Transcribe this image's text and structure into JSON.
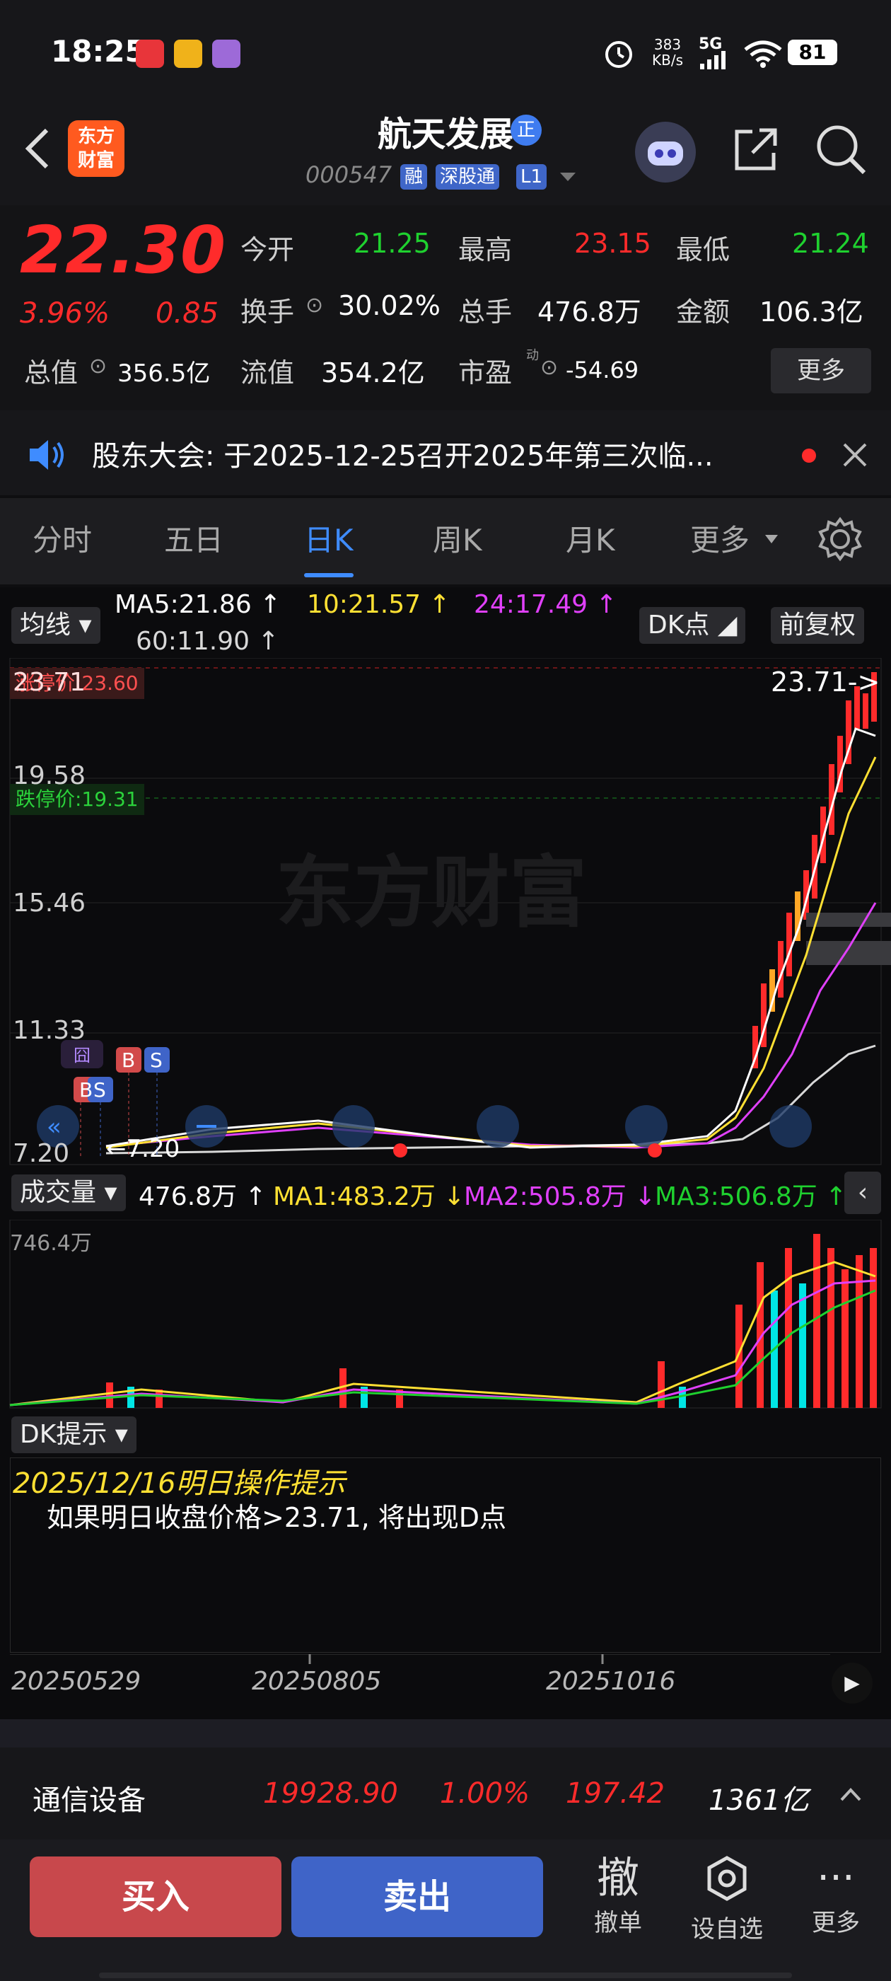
{
  "status_bar": {
    "time": "18:25",
    "net_speed_value": "383",
    "net_speed_unit": "KB/s",
    "network": "5G",
    "battery": "81"
  },
  "header": {
    "app_logo_line1": "东方",
    "app_logo_line2": "财富",
    "stock_name": "航天发展",
    "badge": "正",
    "stock_code": "000547",
    "tags": [
      "融",
      "深股通",
      "L1"
    ]
  },
  "quote": {
    "price": "22.30",
    "change_pct": "3.96%",
    "change_amt": "0.85",
    "open_label": "今开",
    "open": "21.25",
    "high_label": "最高",
    "high": "23.15",
    "low_label": "最低",
    "low": "21.24",
    "turnover_label": "换手",
    "turnover": "30.02%",
    "volume_label": "总手",
    "volume": "476.8万",
    "amount_label": "金额",
    "amount": "106.3亿",
    "mktcap_label": "总值",
    "mktcap": "356.5亿",
    "float_label": "流值",
    "float": "354.2亿",
    "pe_label": "市盈",
    "pe_sup": "动",
    "pe": "-54.69",
    "more_label": "更多"
  },
  "notice": {
    "text": "股东大会: 于2025-12-25召开2025年第三次临..."
  },
  "tabs": [
    {
      "label": "分时",
      "active": false
    },
    {
      "label": "五日",
      "active": false
    },
    {
      "label": "日K",
      "active": true
    },
    {
      "label": "周K",
      "active": false
    },
    {
      "label": "月K",
      "active": false
    },
    {
      "label": "更多",
      "active": false
    }
  ],
  "kline": {
    "ma_button": "均线",
    "ma5": "MA5:21.86",
    "ma10": "10:21.57",
    "ma24": "24:17.49",
    "ma60": "60:11.90",
    "dk_button": "DK点",
    "adjust_button": "前复权",
    "limit_up": "涨停价:23.60",
    "limit_down": "跌停价:19.31",
    "max_arrow": "23.71->",
    "min_arrow": "7.20",
    "y_ticks": [
      "23.71",
      "19.58",
      "15.46",
      "11.33",
      "7.20"
    ],
    "watermark": "东方财富",
    "marker_liang": "囧",
    "marker_b": "B",
    "marker_s": "S"
  },
  "volume": {
    "button": "成交量",
    "value": "476.8万",
    "ma1": "MA1:483.2万",
    "ma2": "MA2:505.8万",
    "ma3": "MA3:506.8万",
    "max_label": "746.4万"
  },
  "dk_tip": {
    "button": "DK提示",
    "title": "2025/12/16明日操作提示",
    "text": "如果明日收盘价格>23.71, 将出现D点"
  },
  "dates": [
    "20250529",
    "20250805",
    "20251016"
  ],
  "sector": {
    "name": "通信设备",
    "index": "19928.90",
    "pct": "1.00%",
    "change": "197.42",
    "amount": "1361亿"
  },
  "bottom": {
    "buy": "买入",
    "sell": "卖出",
    "cancel_icon_text": "撤",
    "cancel_label": "撤单",
    "watch_label": "设自选",
    "more_label": "更多"
  },
  "colors": {
    "up": "#ff2b2b",
    "down": "#1fd12f",
    "ma5": "#ffffff",
    "ma10": "#ffe033",
    "ma24": "#e040fb",
    "ma60": "#d8d8d8",
    "accent": "#3f8cff"
  }
}
